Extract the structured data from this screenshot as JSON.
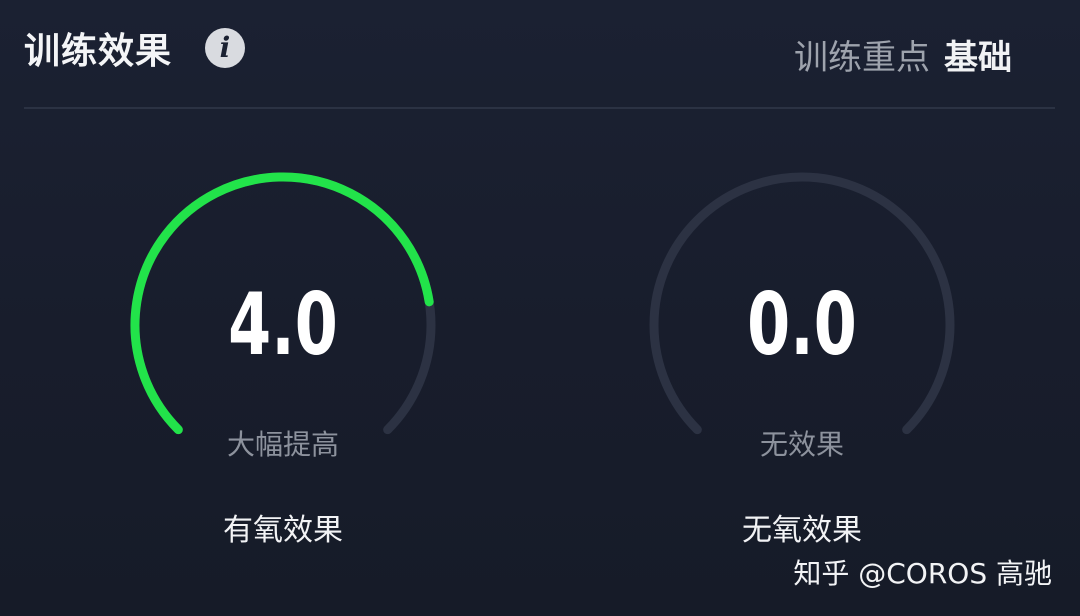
{
  "header": {
    "title": "训练效果",
    "info_icon": "info-icon",
    "focus_label": "训练重点",
    "focus_value": "基础"
  },
  "gauges": [
    {
      "value": "4.0",
      "numeric_value": 4.0,
      "max_value": 5.0,
      "status": "大幅提高",
      "label": "有氧效果",
      "fill_color": "#22e34a",
      "track_color": "#2c3243"
    },
    {
      "value": "0.0",
      "numeric_value": 0.0,
      "max_value": 5.0,
      "status": "无效果",
      "label": "无氧效果",
      "fill_color": "#22e34a",
      "track_color": "#2c3243"
    }
  ],
  "watermark": "知乎 @COROS 高驰"
}
